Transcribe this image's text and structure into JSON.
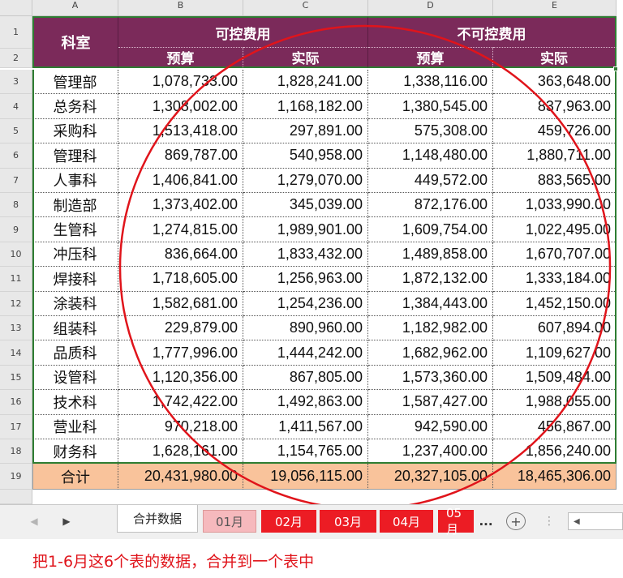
{
  "column_letters": [
    "A",
    "B",
    "C",
    "D",
    "E"
  ],
  "header": {
    "dept_label": "科室",
    "group1": "可控费用",
    "group2": "不可控费用",
    "sub": [
      "预算",
      "实际",
      "预算",
      "实际"
    ]
  },
  "rows": [
    {
      "n": "3",
      "dept": "管理部",
      "v": [
        "1,078,733.00",
        "1,828,241.00",
        "1,338,116.00",
        "363,648.00"
      ]
    },
    {
      "n": "4",
      "dept": "总务科",
      "v": [
        "1,308,002.00",
        "1,168,182.00",
        "1,380,545.00",
        "837,963.00"
      ]
    },
    {
      "n": "5",
      "dept": "采购科",
      "v": [
        "1,513,418.00",
        "297,891.00",
        "575,308.00",
        "459,726.00"
      ]
    },
    {
      "n": "6",
      "dept": "管理科",
      "v": [
        "869,787.00",
        "540,958.00",
        "1,148,480.00",
        "1,880,711.00"
      ]
    },
    {
      "n": "7",
      "dept": "人事科",
      "v": [
        "1,406,841.00",
        "1,279,070.00",
        "449,572.00",
        "883,565.00"
      ]
    },
    {
      "n": "8",
      "dept": "制造部",
      "v": [
        "1,373,402.00",
        "345,039.00",
        "872,176.00",
        "1,033,990.00"
      ]
    },
    {
      "n": "9",
      "dept": "生管科",
      "v": [
        "1,274,815.00",
        "1,989,901.00",
        "1,609,754.00",
        "1,022,495.00"
      ]
    },
    {
      "n": "10",
      "dept": "冲压科",
      "v": [
        "836,664.00",
        "1,833,432.00",
        "1,489,858.00",
        "1,670,707.00"
      ]
    },
    {
      "n": "11",
      "dept": "焊接科",
      "v": [
        "1,718,605.00",
        "1,256,963.00",
        "1,872,132.00",
        "1,333,184.00"
      ]
    },
    {
      "n": "12",
      "dept": "涂装科",
      "v": [
        "1,582,681.00",
        "1,254,236.00",
        "1,384,443.00",
        "1,452,150.00"
      ]
    },
    {
      "n": "13",
      "dept": "组装科",
      "v": [
        "229,879.00",
        "890,960.00",
        "1,182,982.00",
        "607,894.00"
      ]
    },
    {
      "n": "14",
      "dept": "品质科",
      "v": [
        "1,777,996.00",
        "1,444,242.00",
        "1,682,962.00",
        "1,109,627.00"
      ]
    },
    {
      "n": "15",
      "dept": "设管科",
      "v": [
        "1,120,356.00",
        "867,805.00",
        "1,573,360.00",
        "1,509,484.00"
      ]
    },
    {
      "n": "16",
      "dept": "技术科",
      "v": [
        "1,742,422.00",
        "1,492,863.00",
        "1,587,427.00",
        "1,988,055.00"
      ]
    },
    {
      "n": "17",
      "dept": "营业科",
      "v": [
        "970,218.00",
        "1,411,567.00",
        "942,590.00",
        "456,867.00"
      ]
    },
    {
      "n": "18",
      "dept": "财务科",
      "v": [
        "1,628,161.00",
        "1,154,765.00",
        "1,237,400.00",
        "1,856,240.00"
      ]
    }
  ],
  "total": {
    "n": "19",
    "label": "合计",
    "v": [
      "20,431,980.00",
      "19,056,115.00",
      "20,327,105.00",
      "18,465,306.00"
    ]
  },
  "row_numbers_header": [
    "1",
    "2"
  ],
  "tabs": [
    "合并数据",
    "01月",
    "02月",
    "03月",
    "04月",
    "05月"
  ],
  "tab_overflow": "...",
  "caption": "把1-6月这6个表的数据，合并到一个表中",
  "colors": {
    "header_purple": "#7b2a5a",
    "total_fill": "#f9c39b",
    "tab_red": "#ec1c24",
    "annotation_red": "#e0141b"
  }
}
